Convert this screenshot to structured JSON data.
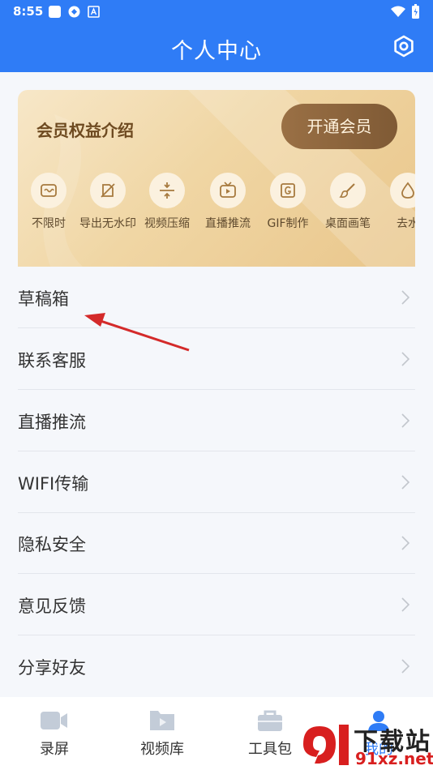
{
  "status_bar": {
    "time": "8:55"
  },
  "header": {
    "title": "个人中心"
  },
  "member_card": {
    "title": "会员权益介绍",
    "button_label": "开通会员",
    "benefits": [
      {
        "label": "不限时",
        "icon": "unlimited-time-icon"
      },
      {
        "label": "导出无水印",
        "icon": "no-watermark-icon"
      },
      {
        "label": "视频压缩",
        "icon": "compress-icon"
      },
      {
        "label": "直播推流",
        "icon": "live-tv-icon"
      },
      {
        "label": "GIF制作",
        "icon": "gif-icon"
      },
      {
        "label": "桌面画笔",
        "icon": "brush-icon"
      },
      {
        "label": "去水",
        "icon": "water-drop-icon"
      }
    ]
  },
  "menu": {
    "items": [
      {
        "label": "草稿箱"
      },
      {
        "label": "联系客服"
      },
      {
        "label": "直播推流"
      },
      {
        "label": "WIFI传输"
      },
      {
        "label": "隐私安全"
      },
      {
        "label": "意见反馈"
      },
      {
        "label": "分享好友"
      }
    ]
  },
  "tabbar": {
    "tabs": [
      {
        "label": "录屏",
        "icon": "video-camera-icon"
      },
      {
        "label": "视频库",
        "icon": "video-library-icon"
      },
      {
        "label": "工具包",
        "icon": "toolbox-icon"
      },
      {
        "label": "我的",
        "icon": "profile-icon",
        "active": true
      }
    ]
  },
  "watermark": {
    "brand": "下载站",
    "domain": "91xz.net"
  },
  "colors": {
    "primary": "#2f7cf6",
    "gold_dark": "#7f5a35",
    "annotation_arrow": "#d42a2a"
  }
}
